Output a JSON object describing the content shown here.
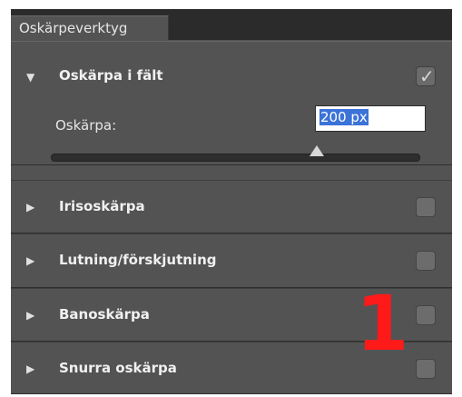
{
  "tab": {
    "label": "Oskärpeverktyg"
  },
  "sections": [
    {
      "label": "Oskärpa i fält",
      "expanded": true,
      "checked": true
    },
    {
      "label": "Irisoskärpa",
      "expanded": false,
      "checked": false
    },
    {
      "label": "Lutning/förskjutning",
      "expanded": false,
      "checked": false
    },
    {
      "label": "Banoskärpa",
      "expanded": false,
      "checked": false
    },
    {
      "label": "Snurra oskärpa",
      "expanded": false,
      "checked": false
    }
  ],
  "field_blur": {
    "param_label": "Oskärpa:",
    "value": "200 px",
    "slider_fraction": 0.72
  },
  "annotation": {
    "text": "1",
    "color": "#ff1a1a"
  },
  "colors": {
    "panel": "#535353",
    "tabbar": "#2b2b2b",
    "selection": "#3b73d8"
  },
  "icons": {
    "expanded": "triangle-down",
    "collapsed": "triangle-right",
    "check": "checkmark"
  }
}
